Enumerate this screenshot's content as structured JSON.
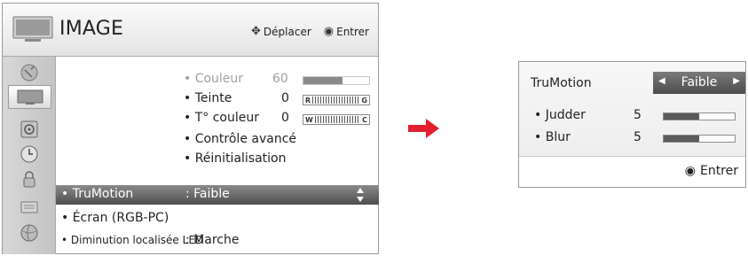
{
  "menu": {
    "title": "IMAGE",
    "hint_move_label": "Déplacer",
    "hint_enter_label": "Entrer",
    "items": {
      "couleur": {
        "label": "• Couleur",
        "value": "60",
        "level": 0.6
      },
      "teinte": {
        "label": "• Teinte",
        "value": "0",
        "left_letter": "R",
        "right_letter": "G"
      },
      "temp_couleur": {
        "label": "• T° couleur",
        "value": "0",
        "left_letter": "W",
        "right_letter": "C"
      },
      "controle": {
        "label": "• Contrôle avancé"
      },
      "reinit": {
        "label": "• Réinitialisation"
      },
      "trumotion": {
        "label": "• TruMotion",
        "value": ": Faible"
      },
      "ecran": {
        "label": "• Écran (RGB-PC)"
      },
      "diminution": {
        "label": "• Diminution localisée LED",
        "value": ": Marche"
      }
    },
    "sidebar_icons": [
      "satellite-dish-icon",
      "picture-icon",
      "speaker-icon",
      "clock-icon",
      "lock-icon",
      "keyboard-icon",
      "globe-icon"
    ]
  },
  "popup": {
    "title": "TruMotion",
    "mode_value": "Faible",
    "judder": {
      "label": "• Judder",
      "value": "5",
      "level": 0.5
    },
    "blur": {
      "label": "• Blur",
      "value": "5",
      "level": 0.5
    },
    "footer_label": "Entrer"
  },
  "colors": {
    "selected": "#5a5a5a",
    "arrow": "#e0202e"
  }
}
